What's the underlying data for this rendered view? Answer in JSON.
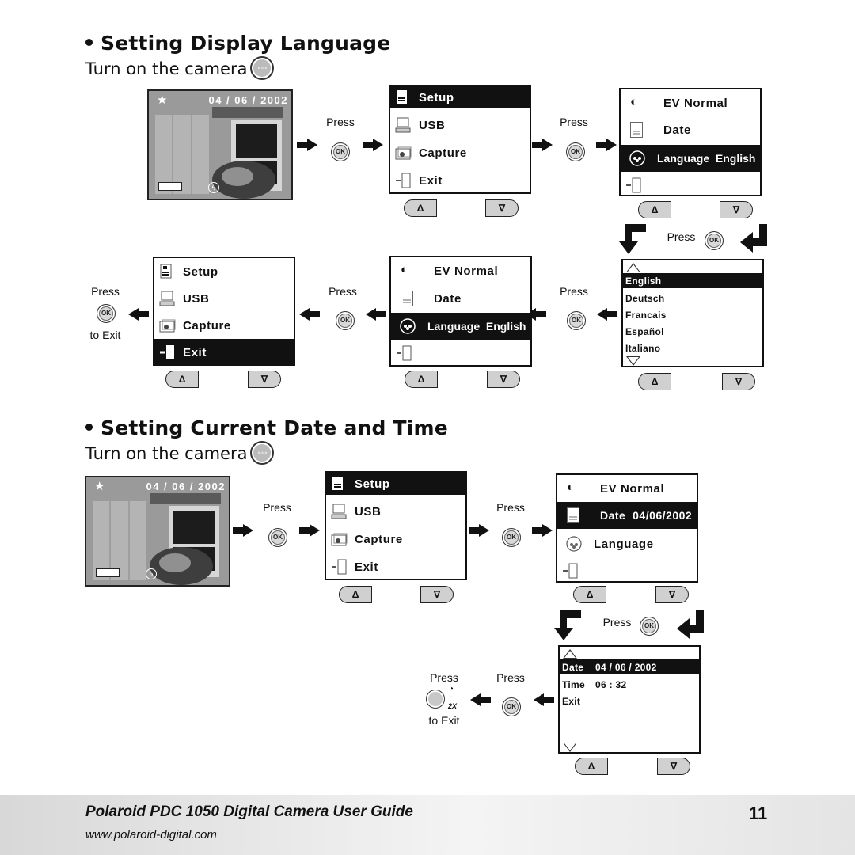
{
  "section1": {
    "title": "Setting Display Language",
    "subtitle": "Turn on the camera",
    "power_icon": "power-button-icon",
    "preview": {
      "date": "04 / 06 / 2002",
      "star": "★"
    },
    "press": "Press",
    "ok_label": "OK",
    "to_exit": "to Exit",
    "setup_menu": {
      "items": [
        "Setup",
        "USB",
        "Capture",
        "Exit"
      ]
    },
    "setup2_menu": {
      "items": [
        "EV Normal",
        "Date",
        "Language  English",
        ""
      ]
    },
    "language_list": {
      "items": [
        "English",
        "Deutsch",
        "Francais",
        "Español",
        "Italiano"
      ],
      "selected": "English"
    },
    "nav": {
      "up": "Δ",
      "down": "∇"
    }
  },
  "section2": {
    "title": "Setting Current Date and Time",
    "subtitle": "Turn on the camera",
    "preview": {
      "date": "04 / 06 / 2002",
      "star": "★"
    },
    "press": "Press",
    "ok_label": "OK",
    "to_exit": "to Exit",
    "timer_label": "2X",
    "setup_menu": {
      "items": [
        "Setup",
        "USB",
        "Capture",
        "Exit"
      ]
    },
    "setup2_menu": {
      "items": [
        "EV Normal",
        "Date  04/06/2002",
        "Language",
        ""
      ]
    },
    "date_list": {
      "rows": [
        {
          "label": "Date",
          "value": "04 / 06 / 2002"
        },
        {
          "label": "Time",
          "value": "06 : 32"
        },
        {
          "label": "Exit",
          "value": ""
        }
      ]
    },
    "nav": {
      "up": "Δ",
      "down": "∇"
    }
  },
  "footer": {
    "title": "Polaroid PDC 1050 Digital Camera User Guide",
    "url": "www.polaroid-digital.com",
    "page": "11"
  }
}
